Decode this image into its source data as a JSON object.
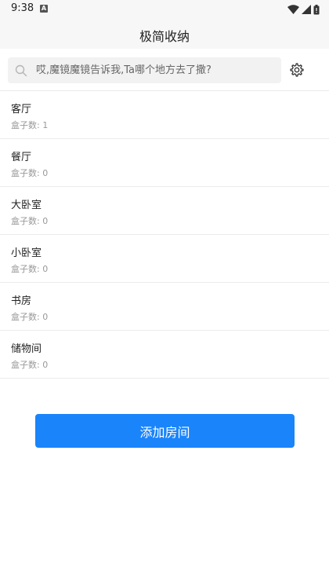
{
  "status_bar": {
    "time": "9:38",
    "notification_badge": "A",
    "icons": [
      "wifi-icon",
      "cell-signal-icon",
      "battery-icon"
    ]
  },
  "header": {
    "title": "极简收纳"
  },
  "search": {
    "placeholder": "哎,魔镜魔镜告诉我,Ta哪个地方去了撒?",
    "value": "",
    "icon": "search-icon"
  },
  "settings": {
    "icon": "gear-icon"
  },
  "rooms": [
    {
      "name": "客厅",
      "count_label": "盒子数: ",
      "count": "1"
    },
    {
      "name": "餐厅",
      "count_label": "盒子数: ",
      "count": "0"
    },
    {
      "name": "大卧室",
      "count_label": "盒子数: ",
      "count": "0"
    },
    {
      "name": "小卧室",
      "count_label": "盒子数: ",
      "count": "0"
    },
    {
      "name": "书房",
      "count_label": "盒子数: ",
      "count": "0"
    },
    {
      "name": "储物间",
      "count_label": "盒子数: ",
      "count": "0"
    }
  ],
  "actions": {
    "add_room_label": "添加房间"
  },
  "colors": {
    "primary": "#1a84fb",
    "header_bg": "#f7f7f7",
    "search_bg": "#f2f2f2",
    "secondary_text": "#999999"
  }
}
